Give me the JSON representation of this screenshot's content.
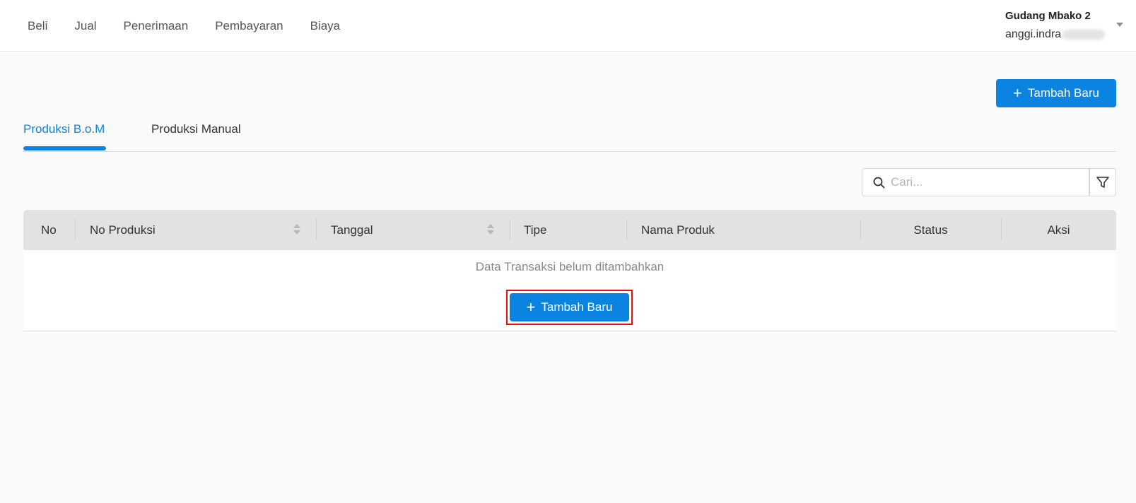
{
  "nav": {
    "items": [
      "Beli",
      "Jual",
      "Penerimaan",
      "Pembayaran",
      "Biaya"
    ]
  },
  "user": {
    "warehouse": "Gudang Mbako 2",
    "email_visible": "anggi.indra"
  },
  "actions": {
    "add_new_label": "Tambah Baru"
  },
  "tabs": [
    {
      "label": "Produksi B.o.M",
      "active": true
    },
    {
      "label": "Produksi Manual",
      "active": false
    }
  ],
  "search": {
    "placeholder": "Cari..."
  },
  "table": {
    "columns": [
      "No",
      "No Produksi",
      "Tanggal",
      "Tipe",
      "Nama Produk",
      "Status",
      "Aksi"
    ],
    "empty_message": "Data Transaksi belum ditambahkan",
    "empty_add_label": "Tambah Baru"
  },
  "colors": {
    "accent": "#0a84e0",
    "highlight": "#e01212",
    "header_bg": "#e2e2e2"
  },
  "icons": {
    "search": "search-icon",
    "filter": "filter-icon",
    "plus": "plus-icon",
    "caret": "chevron-down-icon",
    "sort": "sort-icon"
  }
}
